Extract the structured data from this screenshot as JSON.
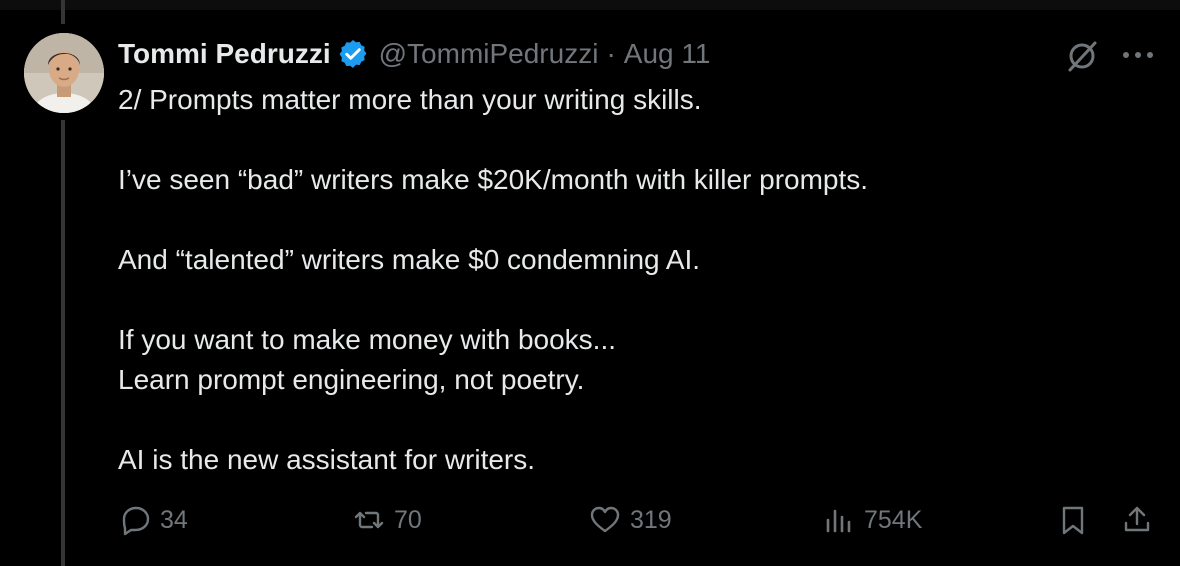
{
  "author": {
    "name": "Tommi Pedruzzi",
    "handle": "@TommiPedruzzi",
    "date": "Aug 11",
    "separator": "·",
    "verified": true
  },
  "tweet": {
    "lines": [
      "2/ Prompts matter more than your writing skills.",
      "",
      "I’ve seen “bad” writers make $20K/month with killer prompts.",
      "",
      "And “talented” writers make $0 condemning AI.",
      "",
      "If you want to make money with books...",
      "Learn prompt engineering, not poetry.",
      "",
      "AI is the new assistant for writers."
    ]
  },
  "actions": {
    "replies": "34",
    "reposts": "70",
    "likes": "319",
    "views": "754K"
  },
  "colors": {
    "background": "#000000",
    "text": "#e7e9ea",
    "muted": "#71767b",
    "verified": "#1d9bf0",
    "thread_line": "#333639"
  },
  "icons": [
    "verified-badge-icon",
    "grok-icon",
    "more-icon",
    "reply-icon",
    "repost-icon",
    "like-icon",
    "views-icon",
    "bookmark-icon",
    "share-icon"
  ]
}
